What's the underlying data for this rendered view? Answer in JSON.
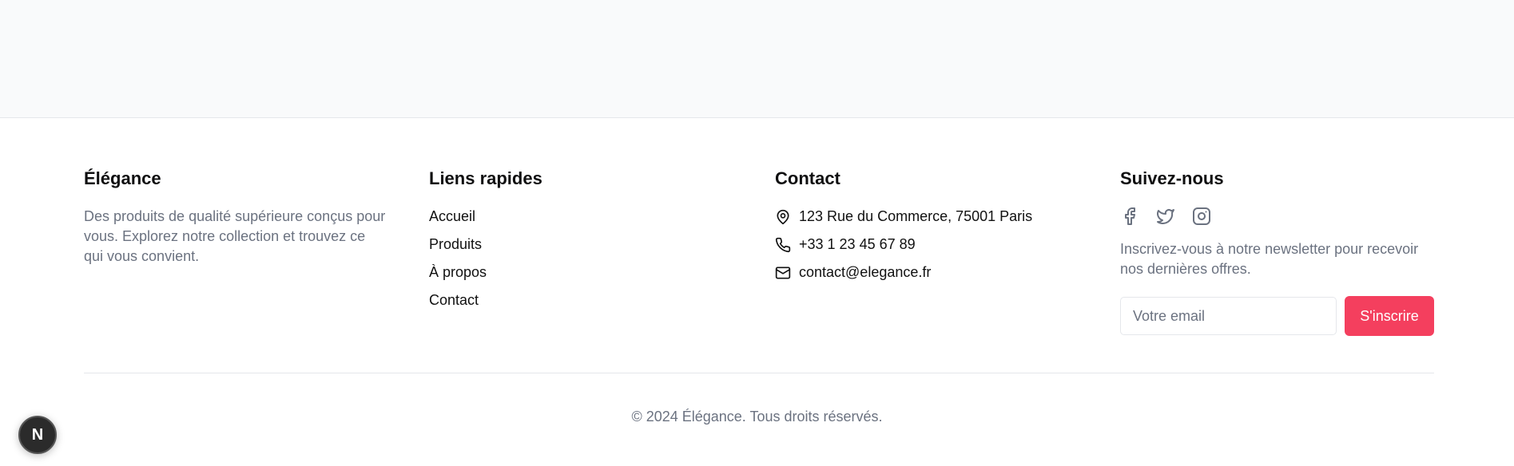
{
  "footer": {
    "brand": {
      "title": "Élégance",
      "description": "Des produits de qualité supérieure conçus pour vous. Explorez notre collection et trouvez ce qui vous convient."
    },
    "quick_links": {
      "title": "Liens rapides",
      "items": [
        "Accueil",
        "Produits",
        "À propos",
        "Contact"
      ]
    },
    "contact": {
      "title": "Contact",
      "address": "123 Rue du Commerce, 75001 Paris",
      "phone": "+33 1 23 45 67 89",
      "email": "contact@elegance.fr",
      "icons": [
        "map-pin-icon",
        "phone-icon",
        "mail-icon"
      ]
    },
    "social": {
      "title": "Suivez-nous",
      "icons": [
        "facebook-icon",
        "twitter-icon",
        "instagram-icon"
      ],
      "newsletter_text": "Inscrivez-vous à notre newsletter pour recevoir nos dernières offres.",
      "email_placeholder": "Votre email",
      "subscribe_label": "S'inscrire"
    },
    "copyright": "© 2024 Élégance. Tous droits réservés."
  },
  "dev_badge": {
    "label": "N"
  },
  "colors": {
    "accent": "#f43f5e",
    "muted_text": "#6b7280",
    "top_background": "#f9fafb"
  }
}
